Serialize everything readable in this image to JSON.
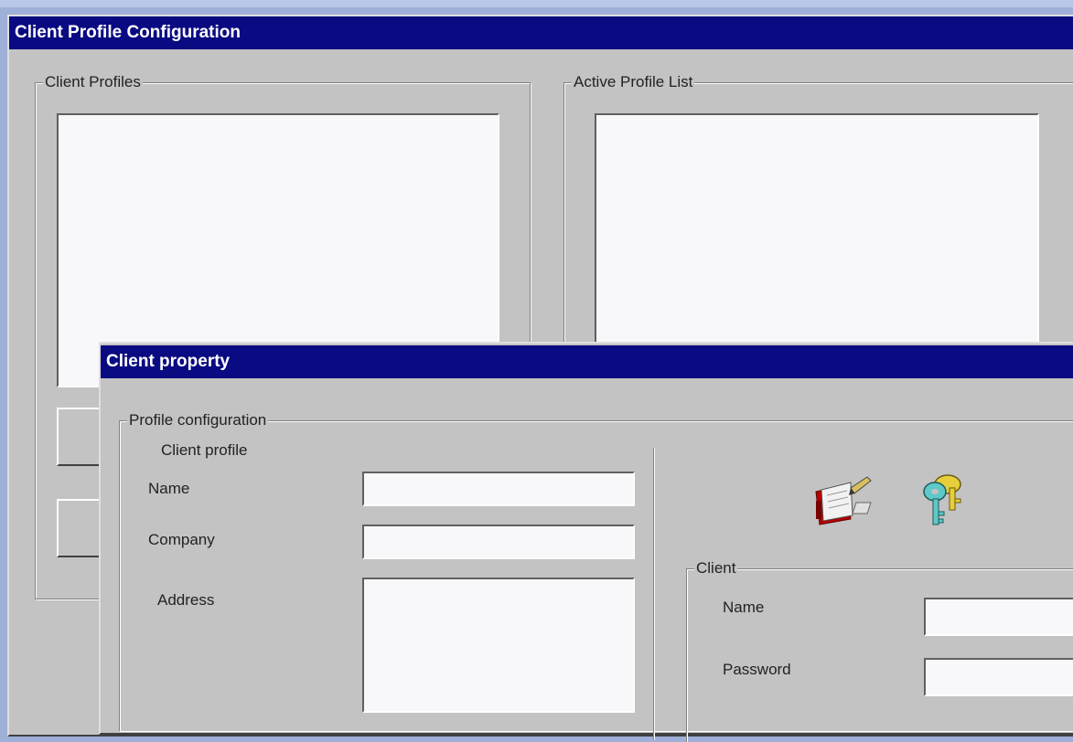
{
  "main_window": {
    "title": "Client Profile Configuration",
    "client_profiles_group": "Client Profiles",
    "active_profile_group": "Active Profile List"
  },
  "dialog": {
    "title": "Client property",
    "profile_config_group": "Profile configuration",
    "client_profile_heading": "Client profile",
    "name_label": "Name",
    "company_label": "Company",
    "address_label": "Address",
    "name_value": "",
    "company_value": "",
    "address_value": "",
    "client_group": "Client",
    "client_name_label": "Name",
    "password_label": "Password",
    "client_name_value": "",
    "password_value": "",
    "icons": [
      "notebook-pencil-icon",
      "keys-icon"
    ]
  }
}
